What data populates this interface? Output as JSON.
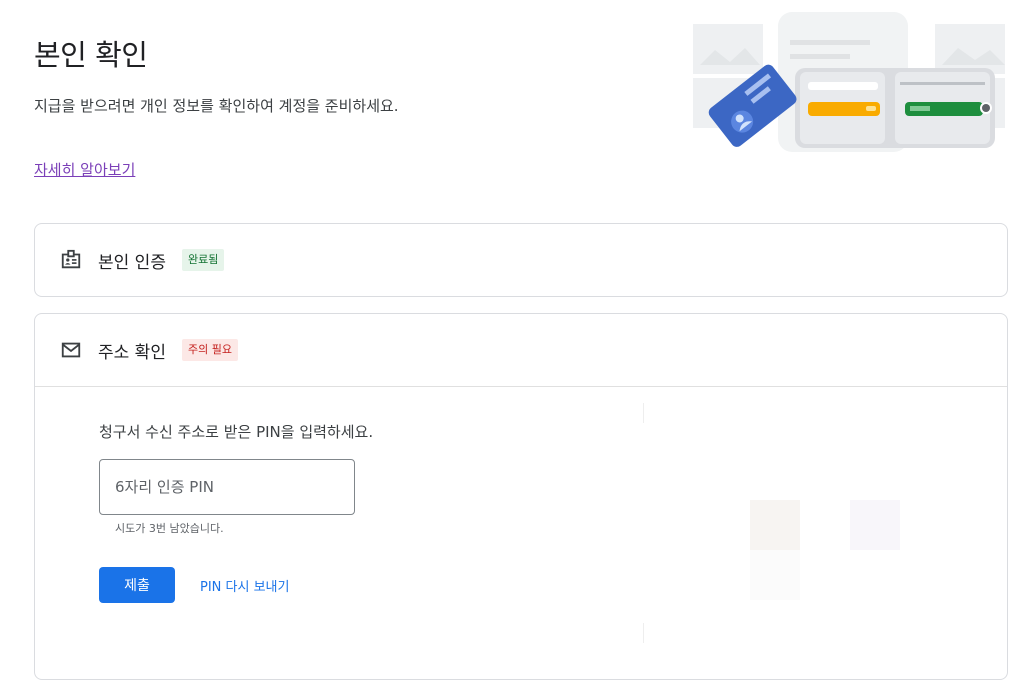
{
  "page": {
    "title": "본인 확인",
    "description": "지급을 받으려면 개인 정보를 확인하여 계정을 준비하세요.",
    "learn_more": "자세히 알아보기"
  },
  "identity_card": {
    "icon": "id-badge-icon",
    "title": "본인 인증",
    "badge": "완료됨"
  },
  "address_card": {
    "icon": "mail-icon",
    "title": "주소 확인",
    "badge": "주의 필요",
    "instruction": "청구서 수신 주소로 받은 PIN을 입력하세요.",
    "pin_placeholder": "6자리 인증 PIN",
    "pin_value": "",
    "attempts_text": "시도가 3번 남았습니다.",
    "submit_label": "제출",
    "resend_label": "PIN 다시 보내기"
  },
  "colors": {
    "primary": "#1a73e8",
    "success_bg": "#e6f4ea",
    "success_text": "#137333",
    "warning_bg": "#fce8e6",
    "warning_text": "#c5221f",
    "link_visited": "#7b3fb8"
  }
}
